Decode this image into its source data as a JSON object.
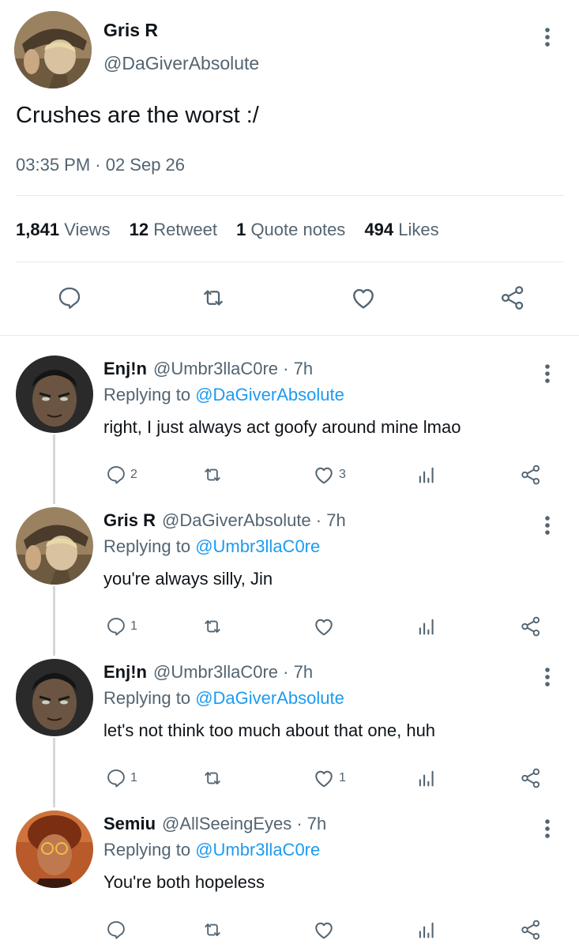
{
  "tweet": {
    "author_name": "Gris R",
    "author_handle": "@DaGiverAbsolute",
    "text": "Crushes are the worst :/",
    "timestamp": "03:35 PM · 02 Sep 26",
    "stats": [
      {
        "value": "1,841",
        "label": "Views"
      },
      {
        "value": "12",
        "label": "Retweet"
      },
      {
        "value": "1",
        "label": "Quote notes"
      },
      {
        "value": "494",
        "label": "Likes"
      }
    ],
    "actions": [
      "reply-icon",
      "retweet-icon",
      "like-icon",
      "share-icon"
    ]
  },
  "replies": [
    {
      "name": "Enj!n",
      "meta": "@Umbr3llaC0re · 7h",
      "replying_prefix": "Replying to",
      "replying_to": "@DaGiverAbsolute",
      "text": "right, I just always act goofy around mine lmao",
      "reply_count": "2",
      "like_count": "3"
    },
    {
      "name": "Gris R",
      "meta": "@DaGiverAbsolute · 7h",
      "replying_prefix": "Replying to",
      "replying_to": "@Umbr3llaC0re",
      "text": "you're always silly, Jin",
      "reply_count": "1",
      "like_count": ""
    },
    {
      "name": "Enj!n",
      "meta": "@Umbr3llaC0re · 7h",
      "replying_prefix": "Replying to",
      "replying_to": "@DaGiverAbsolute",
      "text": "let's not think too much about that one, huh",
      "reply_count": "1",
      "like_count": "1"
    },
    {
      "name": "Semiu",
      "meta": "@AllSeeingEyes · 7h",
      "replying_prefix": "Replying to",
      "replying_to": "@Umbr3llaC0re",
      "text": "You're both hopeless",
      "reply_count": "",
      "like_count": ""
    }
  ],
  "colors": {
    "link": "#1d9bf0",
    "secondary_text": "#536471",
    "primary_text": "#0f1419",
    "icon": "#536471"
  }
}
